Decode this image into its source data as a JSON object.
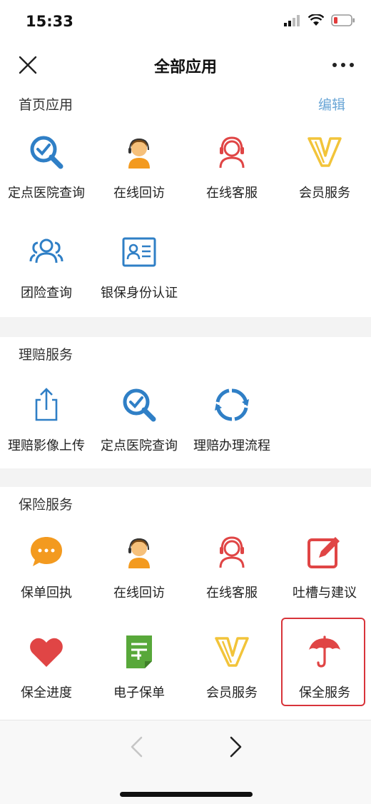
{
  "status_bar": {
    "time": "15:33"
  },
  "nav": {
    "title": "全部应用"
  },
  "sections": {
    "home_apps": {
      "title": "首页应用",
      "edit_label": "编辑",
      "items": [
        {
          "label": "定点医院查询",
          "icon": "magnifier-check-icon"
        },
        {
          "label": "在线回访",
          "icon": "agent-headset-icon"
        },
        {
          "label": "在线客服",
          "icon": "customer-service-icon"
        },
        {
          "label": "会员服务",
          "icon": "v-membership-icon"
        },
        {
          "label": "团险查询",
          "icon": "group-users-icon"
        },
        {
          "label": "银保身份认证",
          "icon": "id-card-icon"
        }
      ]
    },
    "claims": {
      "title": "理赔服务",
      "items": [
        {
          "label": "理赔影像上传",
          "icon": "upload-share-icon"
        },
        {
          "label": "定点医院查询",
          "icon": "magnifier-check-icon"
        },
        {
          "label": "理赔办理流程",
          "icon": "refresh-cycle-icon"
        }
      ]
    },
    "insurance": {
      "title": "保险服务",
      "items": [
        {
          "label": "保单回执",
          "icon": "chat-bubble-icon"
        },
        {
          "label": "在线回访",
          "icon": "agent-headset-icon"
        },
        {
          "label": "在线客服",
          "icon": "customer-service-icon"
        },
        {
          "label": "吐槽与建议",
          "icon": "edit-feedback-icon"
        },
        {
          "label": "保全进度",
          "icon": "heart-icon"
        },
        {
          "label": "电子保单",
          "icon": "e-policy-document-icon"
        },
        {
          "label": "会员服务",
          "icon": "v-membership-icon"
        },
        {
          "label": "保全服务",
          "icon": "umbrella-icon"
        }
      ]
    }
  },
  "colors": {
    "blue": "#2f7fc6",
    "orange": "#f39a1f",
    "red": "#e04545",
    "green": "#58a83a",
    "gold": "#f2c43a",
    "highlight": "#d8343a"
  }
}
